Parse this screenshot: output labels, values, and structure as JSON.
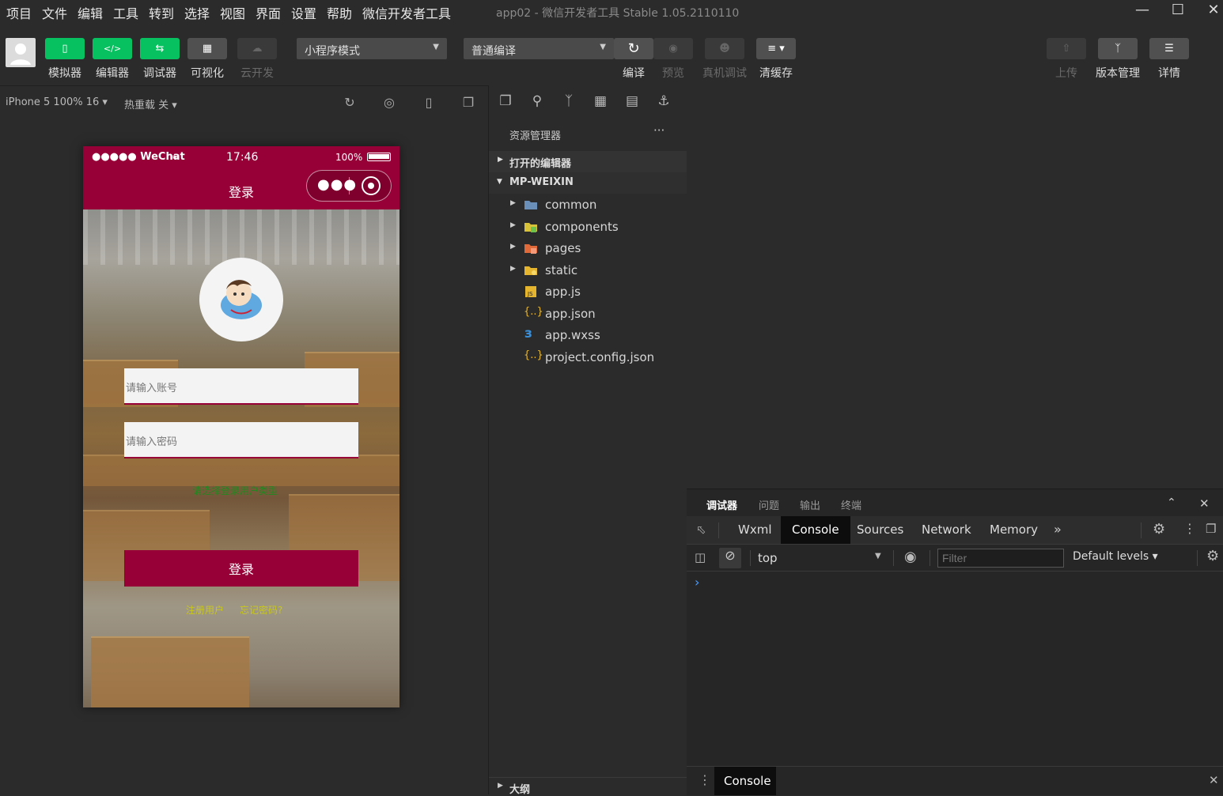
{
  "menubar": {
    "items": [
      "项目",
      "文件",
      "编辑",
      "工具",
      "转到",
      "选择",
      "视图",
      "界面",
      "设置",
      "帮助",
      "微信开发者工具"
    ],
    "window_title": "app02 - 微信开发者工具 Stable 1.05.2110110"
  },
  "toolbar": {
    "left_buttons": [
      {
        "label": "模拟器",
        "icon": "phone-icon"
      },
      {
        "label": "编辑器",
        "icon": "code-icon"
      },
      {
        "label": "调试器",
        "icon": "debug-sliders-icon"
      },
      {
        "label": "可视化",
        "icon": "layout-icon"
      },
      {
        "label": "云开发",
        "icon": "cloud-icon"
      }
    ],
    "mode_select": "小程序模式",
    "compile_select": "普通编译",
    "mid_buttons": [
      {
        "label": "编译",
        "icon": "refresh-icon"
      },
      {
        "label": "预览",
        "icon": "eye-icon"
      },
      {
        "label": "真机调试",
        "icon": "bug-icon"
      },
      {
        "label": "清缓存",
        "icon": "layers-icon"
      }
    ],
    "right_buttons": [
      {
        "label": "上传",
        "icon": "upload-icon"
      },
      {
        "label": "版本管理",
        "icon": "branch-icon"
      },
      {
        "label": "详情",
        "icon": "menu-icon"
      }
    ]
  },
  "simulator": {
    "device": "iPhone 5 100% 16 ▾",
    "hot_reload": "热重载 关 ▾",
    "status": {
      "carrier": "●●●●● WeChat",
      "time": "17:46",
      "battery": "100%"
    },
    "nav_title": "登录",
    "account_placeholder": "请输入账号",
    "password_placeholder": "请输入密码",
    "select_type_text": "请选择登录用户类型",
    "login_button": "登录",
    "register_link": "注册用户",
    "forgot_link": "忘记密码?"
  },
  "explorer": {
    "title": "资源管理器",
    "more": "···",
    "open_editors": "打开的编辑器",
    "project": "MP-WEIXIN",
    "tree": [
      {
        "name": "common",
        "type": "folder",
        "color": "#6a8fb8"
      },
      {
        "name": "components",
        "type": "folder",
        "color": "#d8c23a"
      },
      {
        "name": "pages",
        "type": "folder",
        "color": "#e06a3a"
      },
      {
        "name": "static",
        "type": "folder",
        "color": "#e6b530"
      },
      {
        "name": "app.js",
        "type": "js",
        "color": "#e6b530"
      },
      {
        "name": "app.json",
        "type": "json",
        "color": "#e6b530"
      },
      {
        "name": "app.wxss",
        "type": "css",
        "color": "#3a8fd8"
      },
      {
        "name": "project.config.json",
        "type": "json",
        "color": "#e6b530"
      }
    ],
    "outline": "大纲"
  },
  "debugger": {
    "tabs": [
      "调试器",
      "问题",
      "输出",
      "终端"
    ],
    "devtools_tabs": [
      "Wxml",
      "Console",
      "Sources",
      "Network",
      "Memory"
    ],
    "more_tabs": "»",
    "context": "top",
    "filter_placeholder": "Filter",
    "levels": "Default levels ▾",
    "prompt": "›",
    "drawer_tab": "Console"
  }
}
